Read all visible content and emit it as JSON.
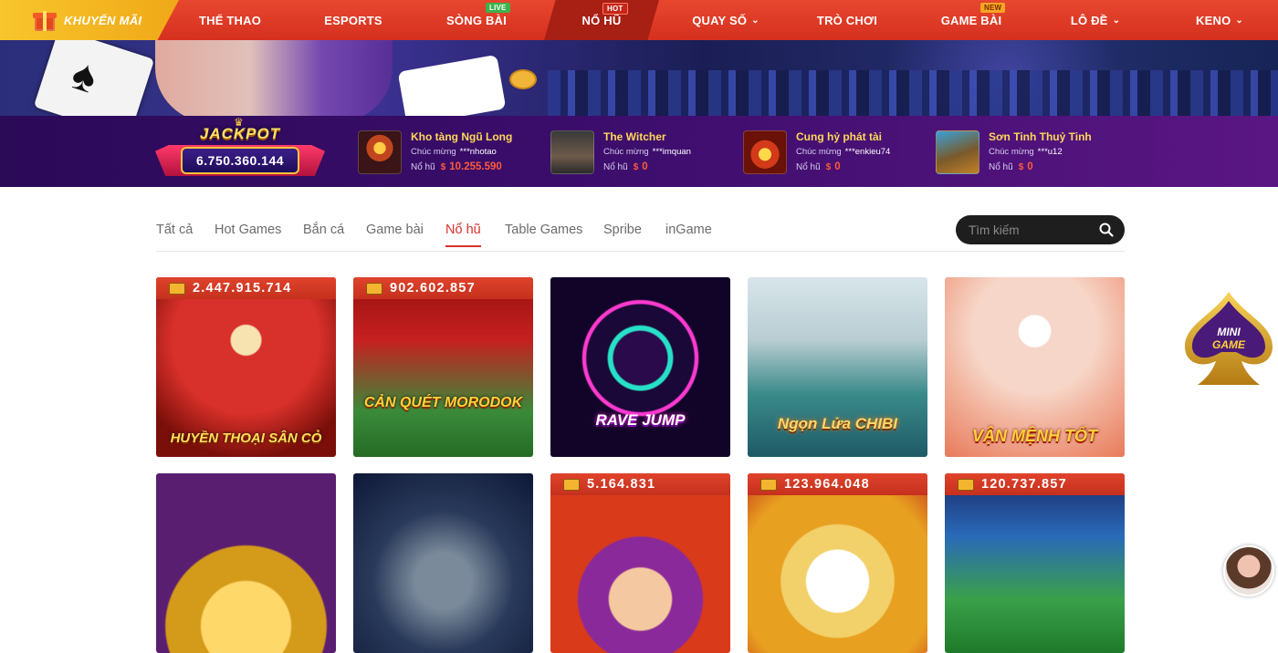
{
  "nav": {
    "promo_label": "KHUYẾN MÃI",
    "items": [
      {
        "label": "THỂ THAO"
      },
      {
        "label": "ESPORTS"
      },
      {
        "label": "SÒNG BÀI",
        "tag": "LIVE"
      },
      {
        "label": "NỔ HŨ",
        "tag": "HOT",
        "active": true
      },
      {
        "label": "QUAY SỐ",
        "dropdown": true
      },
      {
        "label": "TRÒ CHƠI"
      },
      {
        "label": "GAME BÀI",
        "tag": "NEW"
      },
      {
        "label": "LÔ ĐỀ",
        "dropdown": true
      },
      {
        "label": "KENO",
        "dropdown": true
      }
    ],
    "chevron": "⌄"
  },
  "jackpot": {
    "title": "JACKPOT",
    "value": "6.750.360.144",
    "winners": [
      {
        "game": "Kho tàng Ngũ Long",
        "congrats": "Chúc mừng",
        "user": "***nhotao",
        "pot_label": "Nổ hũ",
        "currency": "$",
        "amount": "10.255.590"
      },
      {
        "game": "The Witcher",
        "congrats": "Chúc mừng",
        "user": "***imquan",
        "pot_label": "Nổ hũ",
        "currency": "$",
        "amount": "0"
      },
      {
        "game": "Cung hỷ phát tài",
        "congrats": "Chúc mừng",
        "user": "***enkieu74",
        "pot_label": "Nổ hũ",
        "currency": "$",
        "amount": "0"
      },
      {
        "game": "Sơn Tinh Thuỷ Tinh",
        "congrats": "Chúc mừng",
        "user": "***u12",
        "pot_label": "Nổ hũ",
        "currency": "$",
        "amount": "0"
      }
    ]
  },
  "tabs": {
    "items": [
      "Tất cả",
      "Hot Games",
      "Bắn cá",
      "Game bài",
      "Nổ hũ",
      "Table Games",
      "Spribe",
      "inGame"
    ],
    "active_index": 4,
    "search_placeholder": "Tìm kiếm"
  },
  "games": [
    {
      "title": "HUYỀN THOẠI SÂN CỎ",
      "jackpot": "2.447.915.714"
    },
    {
      "title": "CẢN QUÉT MORODOK",
      "jackpot": "902.602.857"
    },
    {
      "title": "RAVE JUMP",
      "jackpot": ""
    },
    {
      "title": "Ngọn Lửa CHIBI",
      "jackpot": ""
    },
    {
      "title": "VẬN MỆNH TỐT",
      "jackpot": ""
    },
    {
      "title": "",
      "jackpot": ""
    },
    {
      "title": "",
      "jackpot": ""
    },
    {
      "title": "",
      "jackpot": "5.164.831"
    },
    {
      "title": "",
      "jackpot": "123.964.048"
    },
    {
      "title": "",
      "jackpot": "120.737.857"
    }
  ],
  "floating": {
    "mini_game_label": "MINI GAME"
  },
  "colors": {
    "nav_red": "#d5301f",
    "promo_yellow": "#f7c62c",
    "active_tab": "#d8302a",
    "jackpot_purple": "#3b0d6b"
  }
}
